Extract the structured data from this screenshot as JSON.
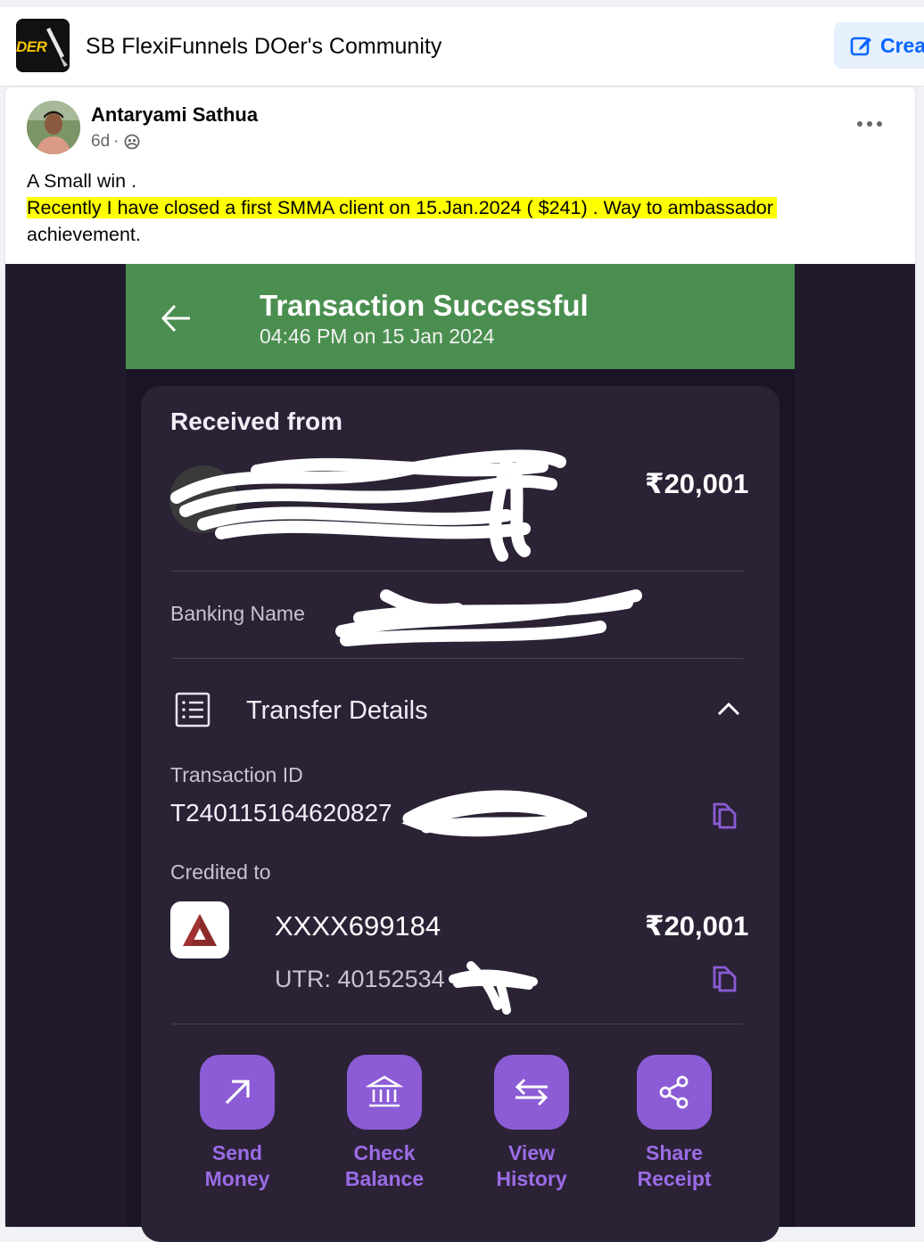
{
  "group": {
    "name": "SB FlexiFunnels DOer's Community",
    "logo_text": "DER",
    "create_label": "Crea"
  },
  "post": {
    "author": "Antaryami Sathua",
    "age": "6d",
    "meta_separator": "·",
    "line1": "A Small win .",
    "line2_highlighted": "Recently I have closed a first SMMA client on 15.Jan.2024 ( $241) . Way to ambassador",
    "line3": "achievement."
  },
  "receipt": {
    "title": "Transaction Successful",
    "time": "04:46 PM on 15 Jan 2024",
    "received_from_label": "Received from",
    "received_amount": "₹20,001",
    "banking_name_label": "Banking Name",
    "transfer_details_label": "Transfer Details",
    "transaction_id_label": "Transaction ID",
    "transaction_id_value": "T240115164620827",
    "credited_to_label": "Credited to",
    "account": "XXXX699184",
    "credited_amount": "₹20,001",
    "utr_label": "UTR: 40152534",
    "actions": [
      {
        "line1": "Send",
        "line2": "Money"
      },
      {
        "line1": "Check",
        "line2": "Balance"
      },
      {
        "line1": "View",
        "line2": "History"
      },
      {
        "line1": "Share",
        "line2": "Receipt"
      }
    ]
  },
  "colors": {
    "facebook_blue": "#0866ff",
    "highlight": "#ffff00",
    "receipt_green": "#4a8f4f",
    "receipt_bg": "#1b1426",
    "card_bg": "#2b2236",
    "action_purple": "#8b5cd6"
  }
}
